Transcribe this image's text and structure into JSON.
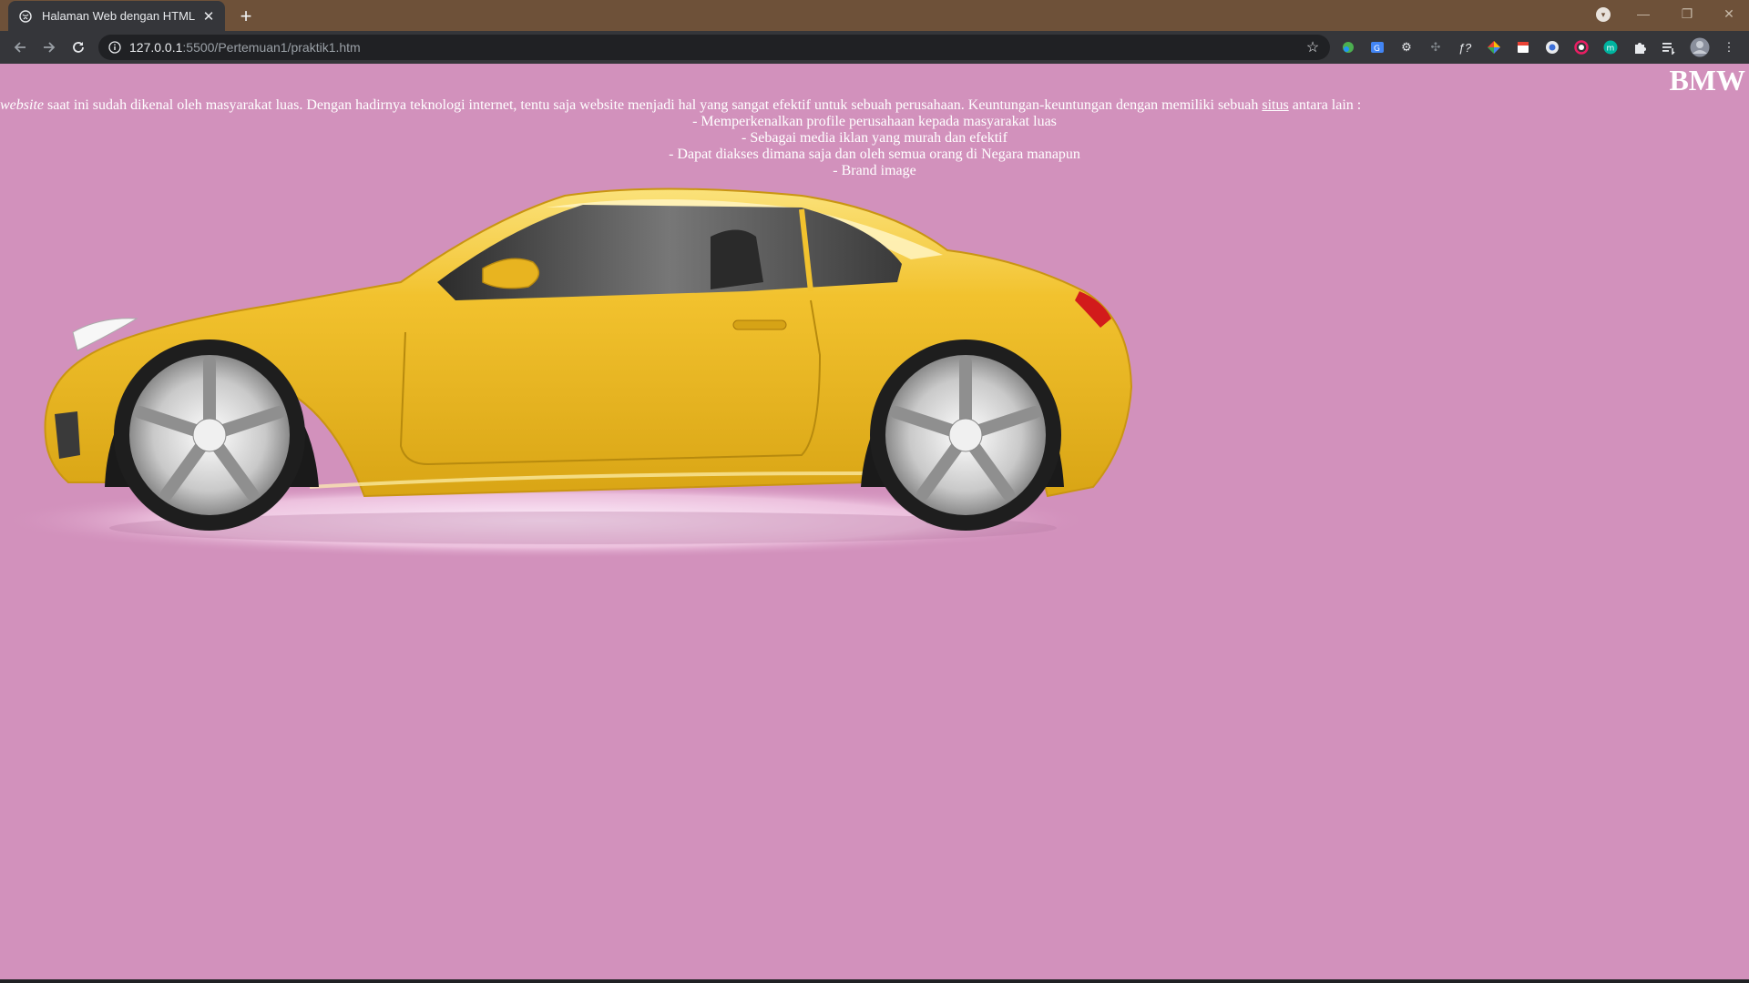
{
  "browser": {
    "tab_title": "Halaman Web dengan HTML",
    "new_tab_label": "+",
    "url_host": "127.0.0.1",
    "url_rest": ":5500/Pertemuan1/praktik1.htm"
  },
  "page": {
    "brand": "BMW",
    "intro_em": "website",
    "intro_text": " saat ini sudah dikenal oleh masyarakat luas. Dengan hadirnya teknologi internet, tentu saja website menjadi hal yang sangat efektif untuk sebuah perusahaan. Keuntungan-keuntungan dengan memiliki sebuah ",
    "intro_link": "situs",
    "intro_tail": " antara lain :",
    "benefits": [
      "- Memperkenalkan profile perusahaan kepada masyarakat luas",
      "- Sebagai media iklan yang murah dan efektif",
      "- Dapat diakses dimana saja dan oleh semua orang di Negara manapun",
      "- Brand image"
    ]
  },
  "colors": {
    "page_bg": "#d291bc",
    "car_body": "#f0c02a",
    "tab_strip": "#6e5139"
  }
}
